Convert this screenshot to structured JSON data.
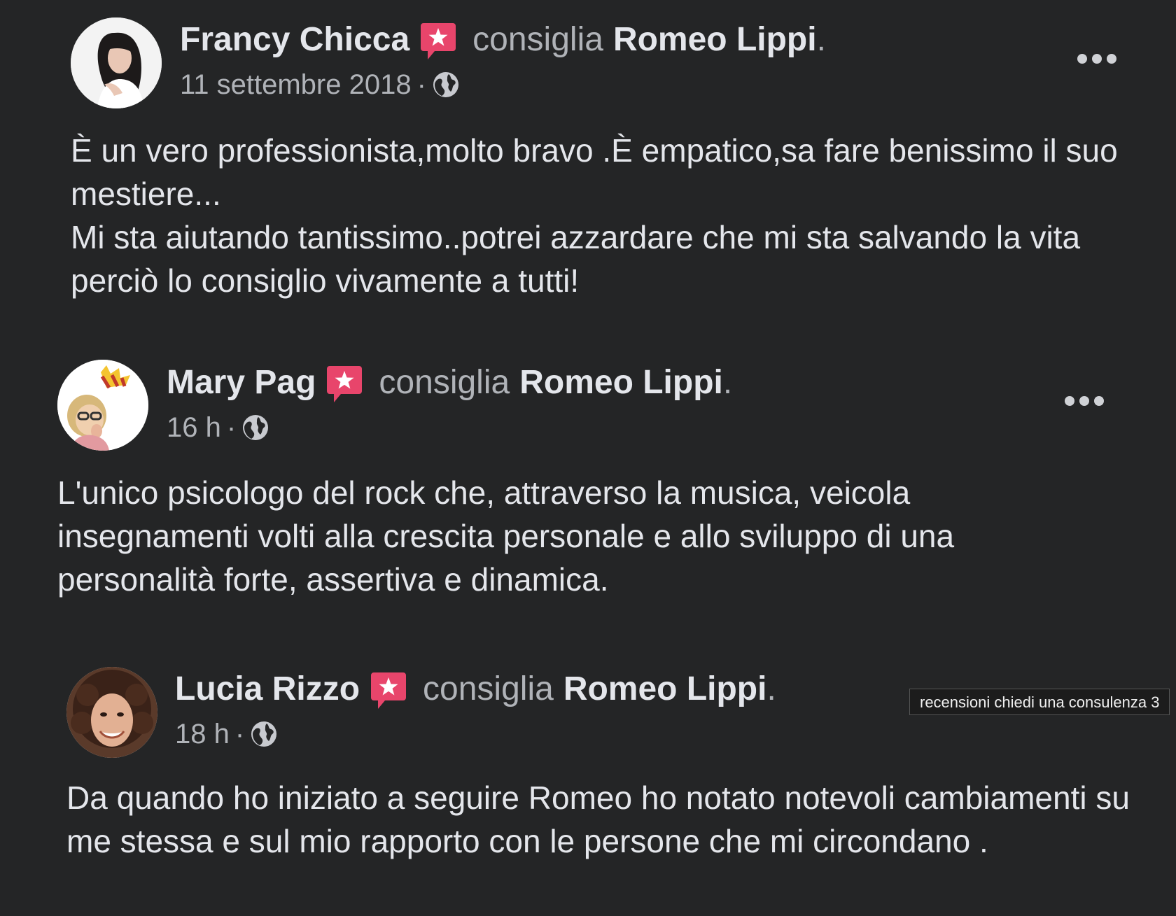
{
  "posts": [
    {
      "author": "Francy Chicca",
      "verb": "consiglia",
      "target": "Romeo Lippi",
      "period": ".",
      "time": "11 settembre 2018",
      "separator": "·",
      "text": "È un vero professionista,molto bravo .È empatico,sa fare benissimo il suo mestiere...\nMi sta aiutando tantissimo..potrei azzardare che mi sta salvando la vita perciò lo consiglio vivamente a tutti!"
    },
    {
      "author": "Mary Pag",
      "verb": "consiglia",
      "target": "Romeo Lippi",
      "period": ".",
      "time": "16 h",
      "separator": "·",
      "text": "L'unico psicologo del rock che, attraverso la musica, veicola insegnamenti volti alla crescita personale e allo sviluppo di una personalità forte, assertiva e dinamica."
    },
    {
      "author": "Lucia Rizzo",
      "verb": "consiglia",
      "target": "Romeo Lippi",
      "period": ".",
      "time": "18 h",
      "separator": "·",
      "text": "Da quando ho iniziato a seguire Romeo ho notato notevoli cambiamenti su me stessa e sul mio rapporto con le persone che mi circondano ."
    }
  ],
  "tooltip": "recensioni chiedi una consulenza 3",
  "icons": {
    "recommend_badge": "recommend-star-icon",
    "audience": "globe-icon",
    "menu": "more-options-icon"
  },
  "colors": {
    "background": "#242526",
    "primary_text": "#e4e6eb",
    "secondary_text": "#b0b3b8",
    "badge": "#e8456b"
  }
}
